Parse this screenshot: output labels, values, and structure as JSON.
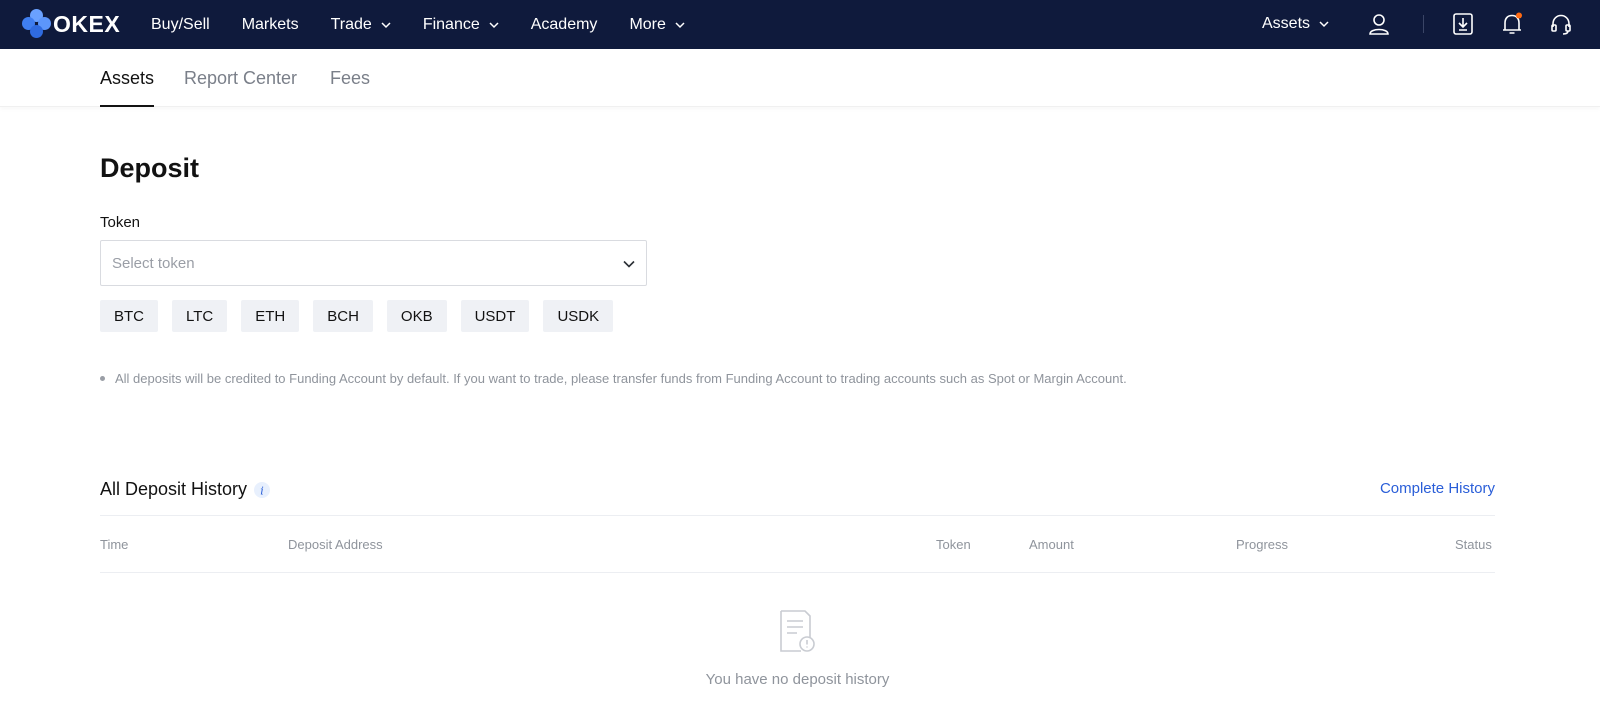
{
  "brand": {
    "name": "OKEX"
  },
  "nav": {
    "items": [
      {
        "label": "Buy/Sell",
        "dropdown": false
      },
      {
        "label": "Markets",
        "dropdown": false
      },
      {
        "label": "Trade",
        "dropdown": true
      },
      {
        "label": "Finance",
        "dropdown": true
      },
      {
        "label": "Academy",
        "dropdown": false
      },
      {
        "label": "More",
        "dropdown": true
      }
    ],
    "assets_label": "Assets",
    "right_icons": [
      "user-icon",
      "download-icon",
      "bell-icon",
      "headset-icon"
    ],
    "notification_dot_color": "#ff6a13"
  },
  "subtabs": [
    {
      "label": "Assets",
      "active": true
    },
    {
      "label": "Report Center",
      "active": false
    },
    {
      "label": "Fees",
      "active": false
    }
  ],
  "deposit": {
    "title": "Deposit",
    "token_label": "Token",
    "token_placeholder": "Select token",
    "tokens": [
      "BTC",
      "LTC",
      "ETH",
      "BCH",
      "OKB",
      "USDT",
      "USDK"
    ],
    "note": "All deposits will be credited to Funding Account by default. If you want to trade, please transfer funds from Funding Account to trading accounts such as Spot or Margin Account."
  },
  "history": {
    "title": "All Deposit History",
    "complete_link": "Complete History",
    "columns": [
      "Time",
      "Deposit Address",
      "Token",
      "Amount",
      "Progress",
      "Status"
    ],
    "empty_text": "You have no deposit history"
  },
  "colors": {
    "navbar_bg": "#0f1a3c",
    "link": "#2a5ed8",
    "chip_bg": "#eff1f5"
  }
}
